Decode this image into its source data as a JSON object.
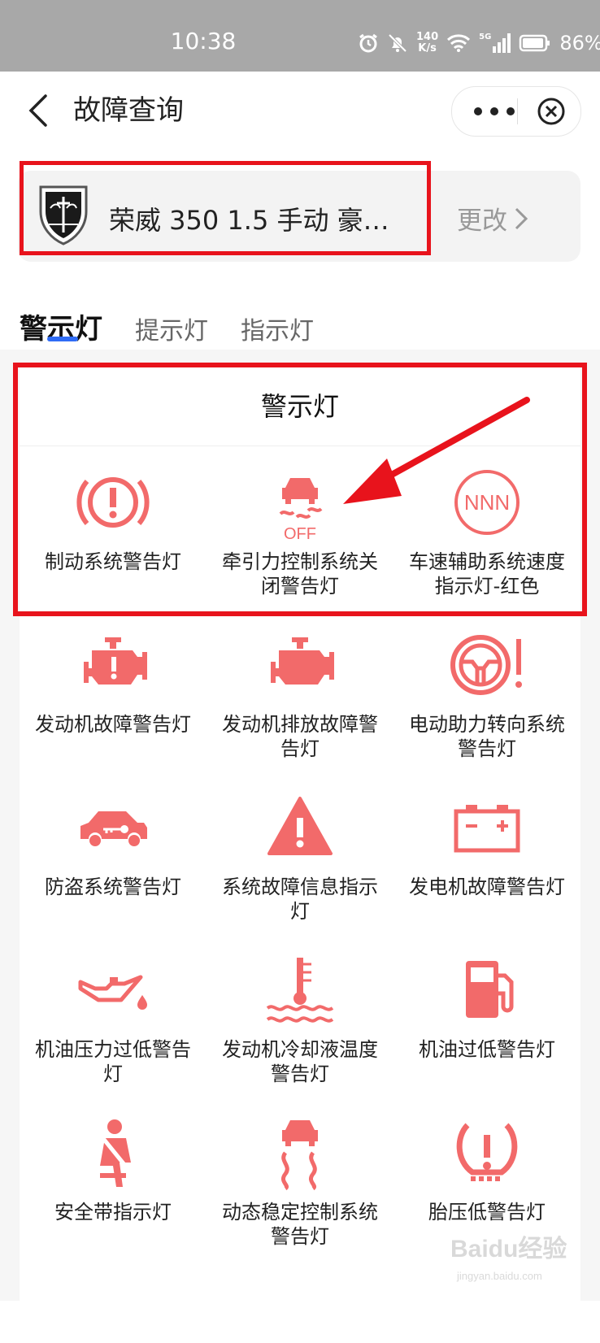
{
  "status": {
    "time": "10:38",
    "net_speed_top": "140",
    "net_speed_bottom": "K/s",
    "net_type": "5G",
    "battery": "86%"
  },
  "header": {
    "title": "故障查询"
  },
  "car": {
    "name": "荣威 350 1.5 手动 豪…",
    "change_label": "更改"
  },
  "tabs": [
    {
      "label": "警示灯"
    },
    {
      "label": "提示灯"
    },
    {
      "label": "指示灯"
    }
  ],
  "section": {
    "title": "警示灯"
  },
  "items": [
    {
      "label": "制动系统警告灯",
      "icon": "brake-warning-icon"
    },
    {
      "label": "牵引力控制系统关闭警告灯",
      "icon": "traction-off-icon",
      "icon_text": "OFF"
    },
    {
      "label": "车速辅助系统速度指示灯-红色",
      "icon": "speed-assist-icon",
      "icon_text": "NNN"
    },
    {
      "label": "发动机故障警告灯",
      "icon": "engine-fault-icon"
    },
    {
      "label": "发动机排放故障警告灯",
      "icon": "engine-emission-icon"
    },
    {
      "label": "电动助力转向系统警告灯",
      "icon": "steering-warning-icon"
    },
    {
      "label": "防盗系统警告灯",
      "icon": "anti-theft-icon"
    },
    {
      "label": "系统故障信息指示灯",
      "icon": "system-fault-icon"
    },
    {
      "label": "发电机故障警告灯",
      "icon": "battery-icon"
    },
    {
      "label": "机油压力过低警告灯",
      "icon": "oil-pressure-icon"
    },
    {
      "label": "发动机冷却液温度警告灯",
      "icon": "coolant-temp-icon"
    },
    {
      "label": "机油过低警告灯",
      "icon": "fuel-low-icon"
    },
    {
      "label": "安全带指示灯",
      "icon": "seatbelt-icon"
    },
    {
      "label": "动态稳定控制系统警告灯",
      "icon": "stability-control-icon"
    },
    {
      "label": "胎压低警告灯",
      "icon": "tire-pressure-icon"
    }
  ],
  "watermark": {
    "text": "Baidu经验",
    "sub": "jingyan.baidu.com"
  },
  "colors": {
    "icon": "#f26a6a",
    "highlight": "#e8131c",
    "tab_underline": "#2f6cf6"
  }
}
